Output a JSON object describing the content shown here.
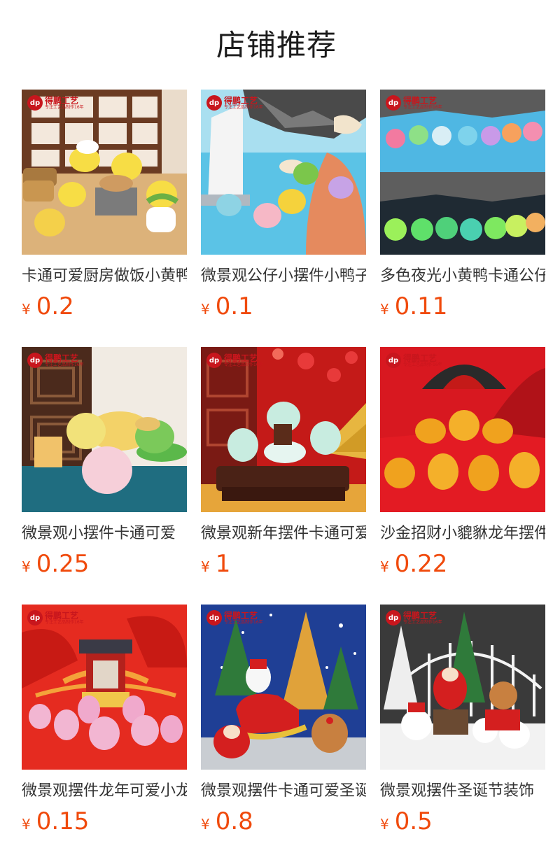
{
  "page_title": "店铺推荐",
  "brand": {
    "name": "得鹏工艺",
    "mark": "dp",
    "sub": "专注工艺品制作16年"
  },
  "currency_symbol": "¥",
  "products": [
    {
      "title": "卡通可爱厨房做饭小黄鸭",
      "price": "0.2",
      "icon": "duck-kitchen-figurine"
    },
    {
      "title": "微景观公仔小摆件小鸭子",
      "price": "0.1",
      "icon": "beach-duck-figurine"
    },
    {
      "title": "多色夜光小黄鸭卡通公仔",
      "price": "0.11",
      "icon": "glow-duck-figurine"
    },
    {
      "title": "微景观小摆件卡通可爱",
      "price": "0.25",
      "icon": "bun-figurine"
    },
    {
      "title": "微景观新年摆件卡通可爱",
      "price": "1",
      "icon": "new-year-dragon-figurine"
    },
    {
      "title": "沙金招财小貔貅龙年摆件",
      "price": "0.22",
      "icon": "gold-pixiu-figurine"
    },
    {
      "title": "微景观摆件龙年可爱小龙",
      "price": "0.15",
      "icon": "pink-dragon-figurine"
    },
    {
      "title": "微景观摆件卡通可爱圣诞",
      "price": "0.8",
      "icon": "christmas-sleigh-figurine"
    },
    {
      "title": "微景观摆件圣诞节装饰",
      "price": "0.5",
      "icon": "snowman-figurine"
    }
  ],
  "colors": {
    "price": "#f04a0c",
    "brand": "#c8161d"
  }
}
